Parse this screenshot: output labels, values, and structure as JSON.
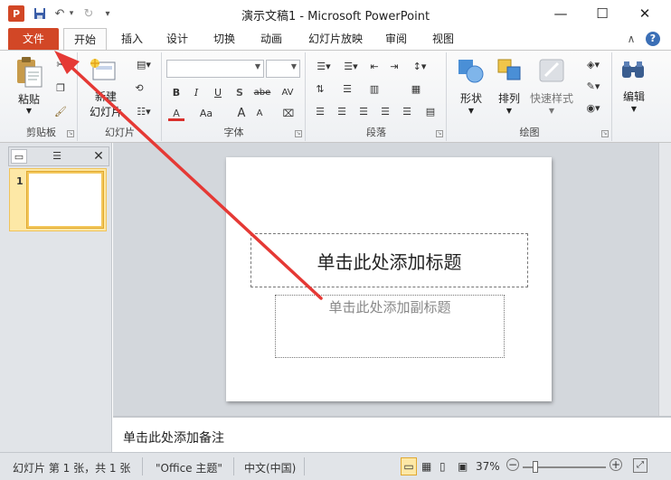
{
  "window": {
    "title": "演示文稿1 - Microsoft PowerPoint",
    "app_icon": "P",
    "minimize": "—",
    "maximize": "☐",
    "close": "✕"
  },
  "qat": {
    "save": "save-icon",
    "undo": "↶",
    "redo": "↻",
    "customize": "▾"
  },
  "tabs": [
    {
      "label": "文件"
    },
    {
      "label": "开始"
    },
    {
      "label": "插入"
    },
    {
      "label": "设计"
    },
    {
      "label": "切换"
    },
    {
      "label": "动画"
    },
    {
      "label": "幻灯片放映"
    },
    {
      "label": "审阅"
    },
    {
      "label": "视图"
    }
  ],
  "tabs_right": {
    "collapse": "∧",
    "help": "?"
  },
  "ribbon": {
    "clipboard": {
      "paste": "粘贴",
      "label": "剪贴板"
    },
    "slides": {
      "new_slide_line1": "新建",
      "new_slide_line2": "幻灯片",
      "label": "幻灯片"
    },
    "font": {
      "bold": "B",
      "italic": "I",
      "underline": "U",
      "shadow": "S",
      "strike": "abe",
      "spacing": "AV",
      "color": "A",
      "case": "Aa",
      "grow": "A",
      "shrink": "A",
      "label": "字体"
    },
    "paragraph": {
      "label": "段落"
    },
    "drawing": {
      "shapes": "形状",
      "arrange": "排列",
      "quick_styles": "快速样式",
      "label": "绘图"
    },
    "editing": {
      "edit": "编辑"
    }
  },
  "slide_panel": {
    "slide_number": "1",
    "close": "✕"
  },
  "slide": {
    "title_placeholder": "单击此处添加标题",
    "subtitle_placeholder": "单击此处添加副标题"
  },
  "notes": {
    "placeholder": "单击此处添加备注"
  },
  "status": {
    "slide_info": "幻灯片 第 1 张，共 1 张",
    "theme": "\"Office 主题\"",
    "language": "中文(中国)",
    "zoom": "37%"
  },
  "colors": {
    "file_tab": "#d24726",
    "ribbon_bg": "#f3f4f6",
    "workspace_bg": "#d3d7dc",
    "annotation_arrow": "#e53935",
    "thumb_highlight": "#fde8a6"
  }
}
